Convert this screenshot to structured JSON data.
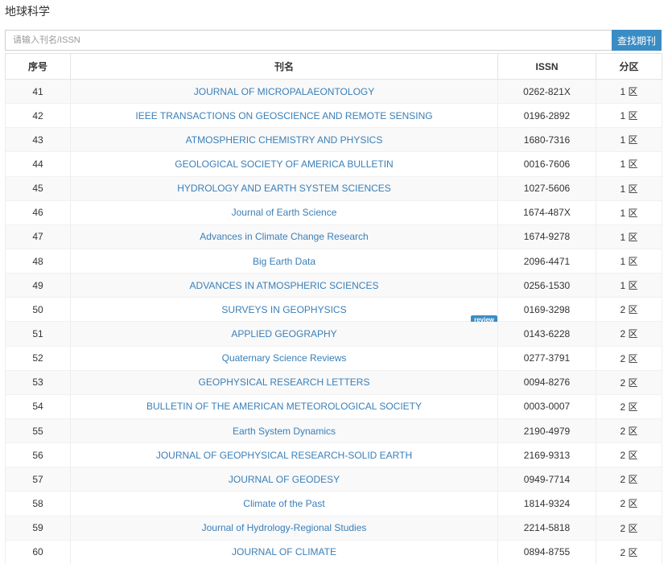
{
  "page": {
    "title": "地球科学"
  },
  "search": {
    "placeholder": "请输入刊名/ISSN",
    "value": "",
    "button_label": "查找期刊"
  },
  "table": {
    "headers": {
      "index": "序号",
      "name": "刊名",
      "issn": "ISSN",
      "zone": "分区"
    },
    "rows": [
      {
        "index": "41",
        "name": "JOURNAL OF MICROPALAEONTOLOGY",
        "issn": "0262-821X",
        "zone": "1 区"
      },
      {
        "index": "42",
        "name": "IEEE TRANSACTIONS ON GEOSCIENCE AND REMOTE SENSING",
        "issn": "0196-2892",
        "zone": "1 区"
      },
      {
        "index": "43",
        "name": "ATMOSPHERIC CHEMISTRY AND PHYSICS",
        "issn": "1680-7316",
        "zone": "1 区"
      },
      {
        "index": "44",
        "name": "GEOLOGICAL SOCIETY OF AMERICA BULLETIN",
        "issn": "0016-7606",
        "zone": "1 区"
      },
      {
        "index": "45",
        "name": "HYDROLOGY AND EARTH SYSTEM SCIENCES",
        "issn": "1027-5606",
        "zone": "1 区"
      },
      {
        "index": "46",
        "name": "Journal of Earth Science",
        "issn": "1674-487X",
        "zone": "1 区"
      },
      {
        "index": "47",
        "name": "Advances in Climate Change Research",
        "issn": "1674-9278",
        "zone": "1 区"
      },
      {
        "index": "48",
        "name": "Big Earth Data",
        "issn": "2096-4471",
        "zone": "1 区"
      },
      {
        "index": "49",
        "name": "ADVANCES IN ATMOSPHERIC SCIENCES",
        "issn": "0256-1530",
        "zone": "1 区"
      },
      {
        "index": "50",
        "name": "SURVEYS IN GEOPHYSICS",
        "issn": "0169-3298",
        "zone": "2 区",
        "badge": "review"
      },
      {
        "index": "51",
        "name": "APPLIED GEOGRAPHY",
        "issn": "0143-6228",
        "zone": "2 区"
      },
      {
        "index": "52",
        "name": "Quaternary Science Reviews",
        "issn": "0277-3791",
        "zone": "2 区"
      },
      {
        "index": "53",
        "name": "GEOPHYSICAL RESEARCH LETTERS",
        "issn": "0094-8276",
        "zone": "2 区"
      },
      {
        "index": "54",
        "name": "BULLETIN OF THE AMERICAN METEOROLOGICAL SOCIETY",
        "issn": "0003-0007",
        "zone": "2 区"
      },
      {
        "index": "55",
        "name": "Earth System Dynamics",
        "issn": "2190-4979",
        "zone": "2 区"
      },
      {
        "index": "56",
        "name": "JOURNAL OF GEOPHYSICAL RESEARCH-SOLID EARTH",
        "issn": "2169-9313",
        "zone": "2 区"
      },
      {
        "index": "57",
        "name": "JOURNAL OF GEODESY",
        "issn": "0949-7714",
        "zone": "2 区"
      },
      {
        "index": "58",
        "name": "Climate of the Past",
        "issn": "1814-9324",
        "zone": "2 区"
      },
      {
        "index": "59",
        "name": "Journal of Hydrology-Regional Studies",
        "issn": "2214-5818",
        "zone": "2 区"
      },
      {
        "index": "60",
        "name": "JOURNAL OF CLIMATE",
        "issn": "0894-8755",
        "zone": "2 区"
      }
    ]
  },
  "footer": {
    "text": ""
  },
  "colors": {
    "accent": "#3a8cc4",
    "link": "#3a7fb8",
    "stripe": "#f9f9f9"
  }
}
